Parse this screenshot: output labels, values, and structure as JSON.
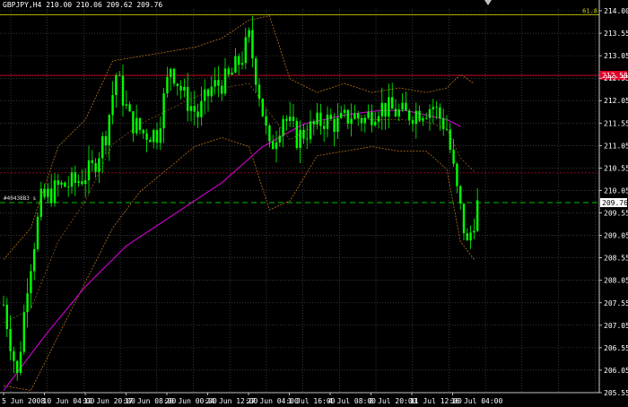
{
  "header": {
    "symbol_text": "GBPJPY,H4",
    "ohlc_text": "210.00 210.06 209.62 209.76"
  },
  "colors": {
    "background": "#000000",
    "grid": "#5a5a5a",
    "candle": "#00ff00",
    "bollinger": "#b8741a",
    "moving_average": "#c400c4",
    "fib_line": "#c8c800",
    "red_level": "#e0002a",
    "order_line": "#00c000",
    "current_price_box": "#ffffff"
  },
  "chart_data": {
    "type": "candlestick",
    "title": "GBPJPY,H4",
    "ylim": [
      205.55,
      214.05
    ],
    "y_ticks": [
      "214.00",
      "213.55",
      "213.05",
      "212.55",
      "212.05",
      "211.55",
      "211.05",
      "210.55",
      "210.05",
      "209.55",
      "209.05",
      "208.55",
      "208.05",
      "207.55",
      "207.05",
      "206.55",
      "206.05",
      "205.55"
    ],
    "x_ticks": [
      "5 Jun 2008",
      "10 Jun 04:00",
      "12 Jun 20:00",
      "17 Jun 08:00",
      "20 Jun 00:00",
      "24 Jun 12:00",
      "27 Jun 04:00",
      "1 Jul 16:00",
      "4 Jul 08:00",
      "8 Jul 20:00",
      "11 Jul 12:00",
      "16 Jul 04:00"
    ],
    "grid": true,
    "current_price": "209.76",
    "levels": [
      {
        "name": "fibonacci",
        "label": "61.8",
        "price": 213.92
      },
      {
        "name": "red-level",
        "label": "212.58",
        "price": 212.58
      },
      {
        "name": "order",
        "label": "#40438B3 s 1",
        "price": 209.76
      },
      {
        "name": "dotted-red",
        "price": 210.42
      }
    ],
    "close_path": [
      [
        0,
        207.5
      ],
      [
        4,
        205.9
      ],
      [
        7,
        208.0
      ],
      [
        11,
        209.8
      ],
      [
        16,
        210.1
      ],
      [
        21,
        210.2
      ],
      [
        26,
        210.5
      ],
      [
        30,
        211.3
      ],
      [
        33,
        212.6
      ],
      [
        37,
        211.6
      ],
      [
        41,
        211.3
      ],
      [
        45,
        211.3
      ],
      [
        49,
        212.8
      ],
      [
        53,
        212.1
      ],
      [
        57,
        211.7
      ],
      [
        61,
        212.3
      ],
      [
        66,
        212.5
      ],
      [
        70,
        213.0
      ],
      [
        72,
        213.4
      ],
      [
        75,
        212.2
      ],
      [
        78,
        210.9
      ],
      [
        82,
        211.7
      ],
      [
        86,
        211.2
      ],
      [
        90,
        211.4
      ],
      [
        94,
        211.6
      ],
      [
        98,
        211.5
      ],
      [
        102,
        211.7
      ],
      [
        106,
        211.6
      ],
      [
        110,
        211.9
      ],
      [
        114,
        211.8
      ],
      [
        118,
        211.7
      ],
      [
        122,
        211.8
      ],
      [
        126,
        211.9
      ],
      [
        130,
        211.4
      ],
      [
        133,
        210.0
      ],
      [
        136,
        208.8
      ],
      [
        139,
        209.7
      ]
    ],
    "moving_average": [
      [
        0,
        205.6
      ],
      [
        12,
        206.8
      ],
      [
        24,
        207.9
      ],
      [
        36,
        208.8
      ],
      [
        50,
        209.5
      ],
      [
        64,
        210.2
      ],
      [
        76,
        211.0
      ],
      [
        88,
        211.5
      ],
      [
        100,
        211.7
      ],
      [
        110,
        211.8
      ],
      [
        118,
        211.8
      ],
      [
        124,
        211.7
      ],
      [
        130,
        211.6
      ],
      [
        134,
        211.45
      ]
    ],
    "bollinger_upper": [
      [
        0,
        208.5
      ],
      [
        8,
        209.2
      ],
      [
        16,
        211.0
      ],
      [
        24,
        211.6
      ],
      [
        32,
        212.9
      ],
      [
        40,
        213.0
      ],
      [
        48,
        213.1
      ],
      [
        56,
        213.2
      ],
      [
        64,
        213.4
      ],
      [
        72,
        213.8
      ],
      [
        78,
        213.9
      ],
      [
        84,
        212.5
      ],
      [
        92,
        212.2
      ],
      [
        100,
        212.4
      ],
      [
        108,
        212.2
      ],
      [
        116,
        212.3
      ],
      [
        124,
        212.2
      ],
      [
        130,
        212.3
      ],
      [
        134,
        212.6
      ],
      [
        138,
        212.4
      ]
    ],
    "bollinger_lower": [
      [
        0,
        205.7
      ],
      [
        8,
        205.6
      ],
      [
        16,
        206.8
      ],
      [
        24,
        208.0
      ],
      [
        32,
        209.2
      ],
      [
        40,
        210.0
      ],
      [
        48,
        210.5
      ],
      [
        56,
        211.0
      ],
      [
        64,
        211.2
      ],
      [
        72,
        211.0
      ],
      [
        78,
        209.6
      ],
      [
        84,
        209.8
      ],
      [
        92,
        210.8
      ],
      [
        100,
        210.9
      ],
      [
        108,
        211.0
      ],
      [
        116,
        210.9
      ],
      [
        124,
        210.9
      ],
      [
        130,
        210.5
      ],
      [
        134,
        208.9
      ],
      [
        138,
        208.5
      ]
    ]
  }
}
